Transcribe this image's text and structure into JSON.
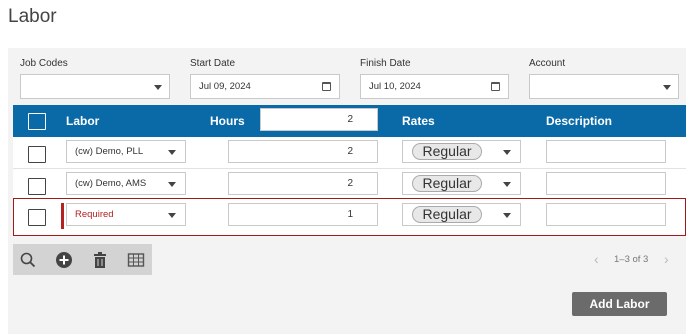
{
  "page": {
    "title": "Labor"
  },
  "filters": {
    "job_codes": {
      "label": "Job Codes",
      "value": ""
    },
    "start_date": {
      "label": "Start Date",
      "value": "Jul 09, 2024"
    },
    "finish_date": {
      "label": "Finish Date",
      "value": "Jul 10, 2024"
    },
    "account": {
      "label": "Account",
      "value": ""
    }
  },
  "table": {
    "headers": {
      "labor": "Labor",
      "hours": "Hours",
      "rates": "Rates",
      "description": "Description"
    },
    "hours_default": "2",
    "rows": [
      {
        "labor": "(cw) Demo, PLL",
        "hours": "2",
        "rate": "Regular",
        "description": ""
      },
      {
        "labor": "(cw) Demo, AMS",
        "hours": "2",
        "rate": "Regular",
        "description": ""
      },
      {
        "labor": "Required",
        "hours": "1",
        "rate": "Regular",
        "description": "",
        "error": true
      }
    ]
  },
  "toolbar": {
    "icons": [
      "search-icon",
      "add-icon",
      "trash-icon",
      "table-icon"
    ]
  },
  "pager": {
    "text": "1–3 of 3"
  },
  "actions": {
    "add_labor": "Add Labor"
  },
  "colors": {
    "header_bg": "#0a6aa8",
    "error": "#b22222",
    "button_bg": "#6b6b6b"
  }
}
